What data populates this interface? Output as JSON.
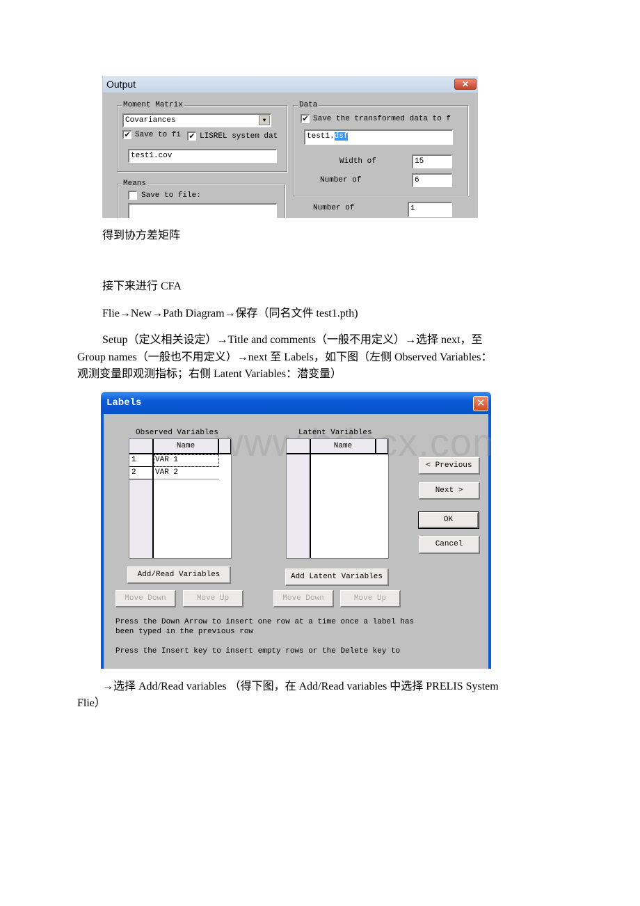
{
  "output_dialog": {
    "title": "Output",
    "moment_matrix": {
      "group_label": "Moment Matrix",
      "type_selected": "Covariances",
      "save_to_file_label": "Save to fi",
      "save_to_file_checked": true,
      "lisrel_label": "LISREL system dat",
      "lisrel_checked": true,
      "filename": "test1.cov"
    },
    "means": {
      "group_label": "Means",
      "save_to_file_label": "Save to file:",
      "save_to_file_checked": false,
      "filename": ""
    },
    "data": {
      "group_label": "Data",
      "save_transformed_label": "Save the transformed data to f",
      "save_transformed_checked": true,
      "filename_prefix": "test1.",
      "filename_selected": "dsf",
      "width_label": "Width of",
      "width_value": "15",
      "number_label": "Number of",
      "number_value": "6"
    },
    "number_of_label": "Number of",
    "number_of_value": "1"
  },
  "document": {
    "p1": "得到协方差矩阵",
    "p2": "接下来进行 CFA",
    "p3": "Flie→New→Path Diagram→保存（同名文件 test1.pth)",
    "p4_line1": "Setup（定义相关设定）→Title and comments（一般不用定义）→选择 next，至",
    "p4_line2": "Group names（一般也不用定义）→next 至 Labels，如下图（左侧 Observed Variables：",
    "p4_line3": "观测变量即观测指标；右侧 Latent Variables：潜变量）",
    "p5_line1": "→选择 Add/Read variables （得下图，在 Add/Read variables 中选择 PRELIS System",
    "p5_line2": "Flie）"
  },
  "labels_dialog": {
    "title": "Labels",
    "watermark": "www.bdocx.com",
    "observed": {
      "heading": "Observed Variables",
      "column_header": "Name",
      "rows": [
        {
          "num": "1",
          "name": "VAR 1"
        },
        {
          "num": "2",
          "name": "VAR 2"
        }
      ],
      "add_button": "Add/Read Variables",
      "move_down": "Move Down",
      "move_up": "Move Up"
    },
    "latent": {
      "heading": "Latent Variables",
      "column_header": "Name",
      "rows": [],
      "add_button": "Add Latent Variables",
      "move_down": "Move Down",
      "move_up": "Move Up"
    },
    "buttons": {
      "previous": "< Previous",
      "next": "Next >",
      "ok": "OK",
      "cancel": "Cancel"
    },
    "help_line1": "Press the Down Arrow to insert one row at a time once a label has",
    "help_line2": "been typed in the previous row",
    "help_line3": "Press the Insert key to insert empty rows or the Delete key to"
  }
}
